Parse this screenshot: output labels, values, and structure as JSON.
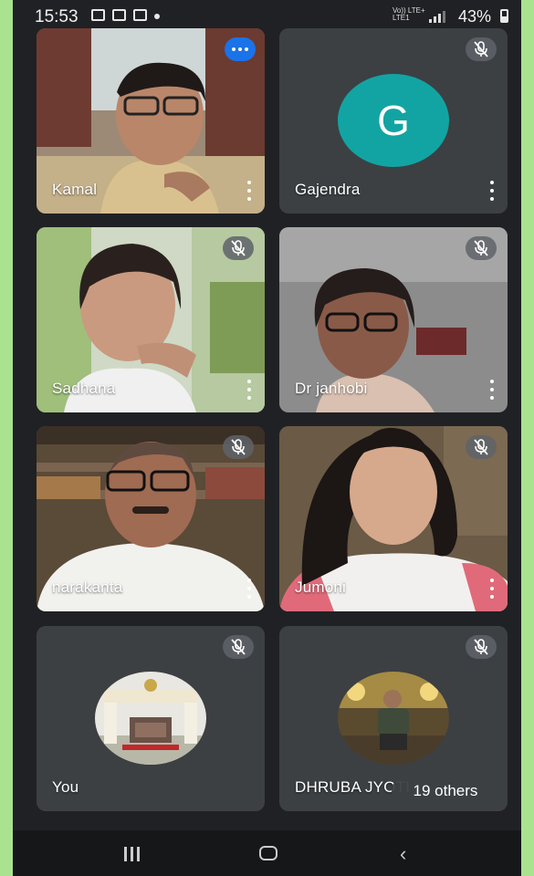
{
  "status_bar": {
    "time": "15:53",
    "network": "Vo)) LTE+\nLTE1",
    "battery": "43%",
    "icons": [
      "gallery-icon",
      "mail-icon",
      "book-icon",
      "dot-icon",
      "signal-icon",
      "battery-icon"
    ]
  },
  "participants": [
    {
      "name": "Kamal",
      "state": "speaking"
    },
    {
      "name": "Gajendra",
      "avatar_letter": "G",
      "avatar_color": "#12a4a3",
      "state": "muted"
    },
    {
      "name": "Sadhana",
      "state": "muted"
    },
    {
      "name": "Dr janhobi",
      "state": "muted"
    },
    {
      "name": "narakanta",
      "state": "muted"
    },
    {
      "name": "Jumoni",
      "state": "muted"
    },
    {
      "name": "You",
      "state": "muted"
    },
    {
      "name": "DHRUBA JYOTI",
      "state": "muted"
    }
  ],
  "others_label": "19 others",
  "colors": {
    "background": "#202124",
    "tile": "#3c4043",
    "speaking": "#1a73e8",
    "frame": "#a9e38f"
  },
  "nav_icons": [
    "recents-icon",
    "home-icon",
    "back-icon"
  ]
}
